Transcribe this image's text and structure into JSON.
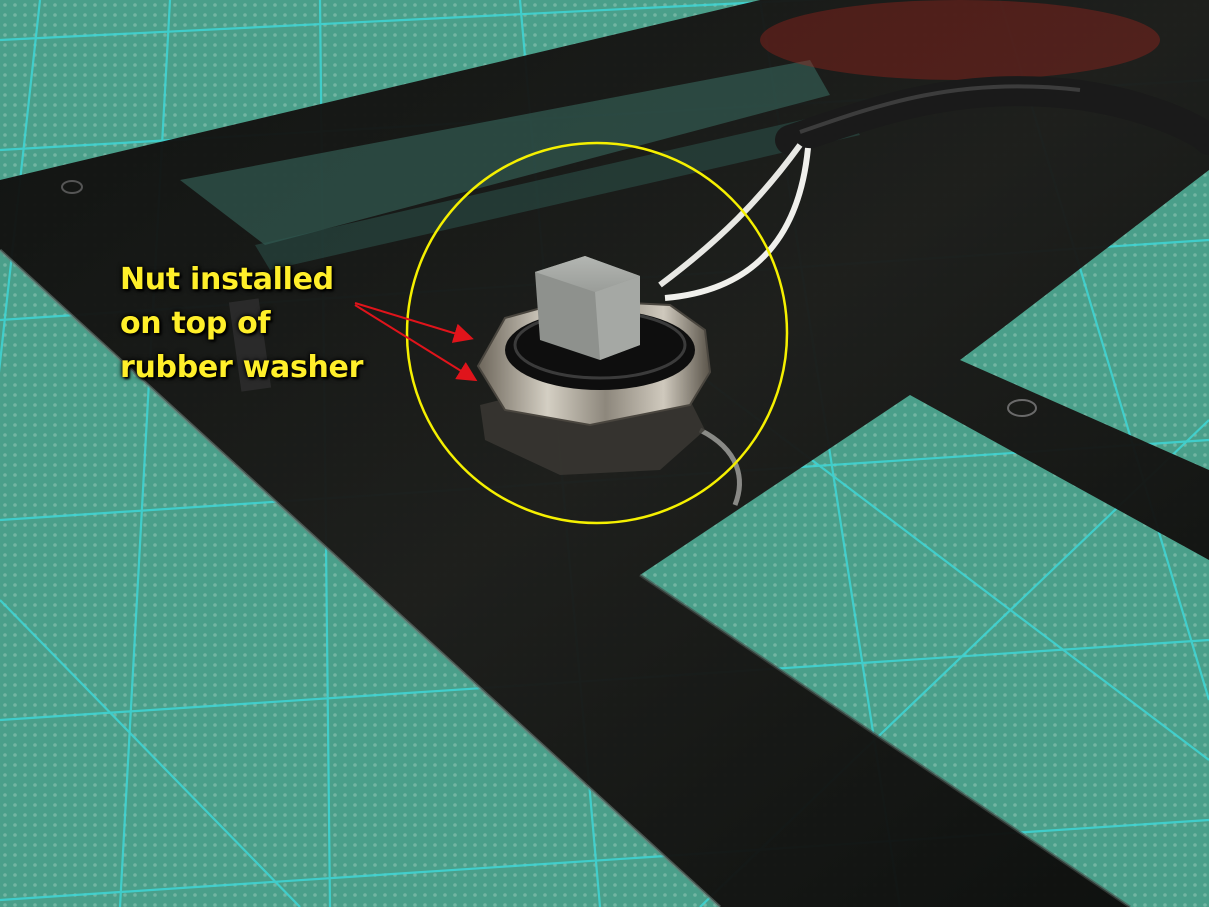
{
  "annotation": {
    "lines": [
      "Nut installed",
      "on top of",
      "rubber washer"
    ],
    "text_color": "#ffef2a",
    "arrow_color": "#e0141b",
    "highlight_circle_color": "#f5f000"
  },
  "scene": {
    "subjects": [
      "cutting-mat",
      "acrylic-plate",
      "hex-nut",
      "rubber-washer",
      "push-button-cap",
      "white-wires",
      "black-braided-sleeve"
    ],
    "colors": {
      "mat": "#4a9f8a",
      "mat_grid": "#3fd6d6",
      "acrylic": "#141312",
      "nut": "#b9b4a8",
      "button_cap": "#9da09c"
    }
  }
}
